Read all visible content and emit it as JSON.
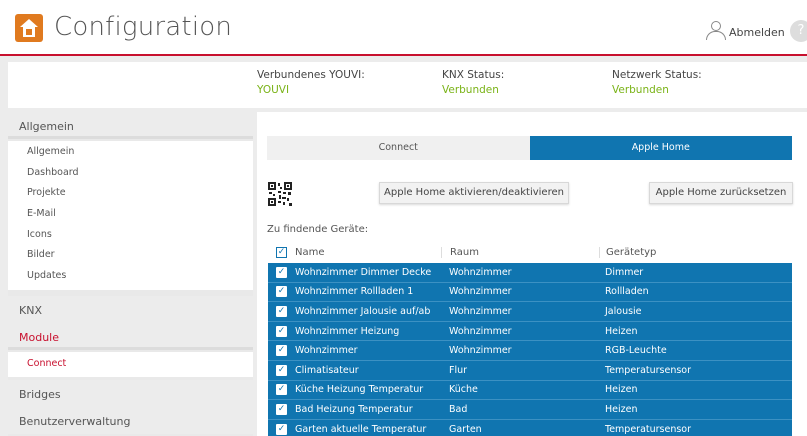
{
  "header": {
    "title": "Configuration",
    "logout_label": "Abmelden",
    "help_glyph": "?"
  },
  "status": {
    "youvi": {
      "label": "Verbundenes YOUVI:",
      "value": "YOUVI"
    },
    "knx": {
      "label": "KNX Status:",
      "value": "Verbunden"
    },
    "network": {
      "label": "Netzwerk Status:",
      "value": "Verbunden"
    }
  },
  "sidebar": {
    "sections": [
      {
        "label": "Allgemein",
        "items": [
          "Allgemein",
          "Dashboard",
          "Projekte",
          "E-Mail",
          "Icons",
          "Bilder",
          "Updates"
        ]
      },
      {
        "label": "KNX"
      },
      {
        "label": "Module",
        "active": true,
        "items": [
          "Connect"
        ]
      },
      {
        "label": "Bridges"
      },
      {
        "label": "Benutzerverwaltung"
      }
    ]
  },
  "tabs": [
    {
      "label": "Connect",
      "active": false
    },
    {
      "label": "Apple Home",
      "active": true
    }
  ],
  "actions": {
    "toggle_label": "Apple Home aktivieren/deaktivieren",
    "reset_label": "Apple Home zurücksetzen"
  },
  "devices": {
    "title": "Zu findende Geräte:",
    "columns": {
      "name": "Name",
      "room": "Raum",
      "type": "Gerätetyp"
    },
    "rows": [
      {
        "name": "Wohnzimmer Dimmer Decke",
        "room": "Wohnzimmer",
        "type": "Dimmer"
      },
      {
        "name": "Wohnzimmer Rollladen 1",
        "room": "Wohnzimmer",
        "type": "Rollladen"
      },
      {
        "name": "Wohnzimmer Jalousie auf/ab",
        "room": "Wohnzimmer",
        "type": "Jalousie"
      },
      {
        "name": "Wohnzimmer Heizung",
        "room": "Wohnzimmer",
        "type": "Heizen"
      },
      {
        "name": "Wohnzimmer",
        "room": "Wohnzimmer",
        "type": "RGB-Leuchte"
      },
      {
        "name": "Climatisateur",
        "room": "Flur",
        "type": "Temperatursensor"
      },
      {
        "name": "Küche Heizung Temperatur",
        "room": "Küche",
        "type": "Heizen"
      },
      {
        "name": "Bad Heizung Temperatur",
        "room": "Bad",
        "type": "Heizen"
      },
      {
        "name": "Garten aktuelle Temperatur",
        "room": "Garten",
        "type": "Temperatursensor"
      }
    ]
  },
  "colors": {
    "accent": "#c8102e",
    "selected_row": "#1075b0",
    "status_ok": "#7ab317",
    "logo": "#e07a1f"
  },
  "icons": {
    "logo": "youvi-house-icon",
    "user": "user-icon",
    "help": "help-icon",
    "qr": "qr-code-icon",
    "checkbox": "checkbox-checked-icon"
  }
}
